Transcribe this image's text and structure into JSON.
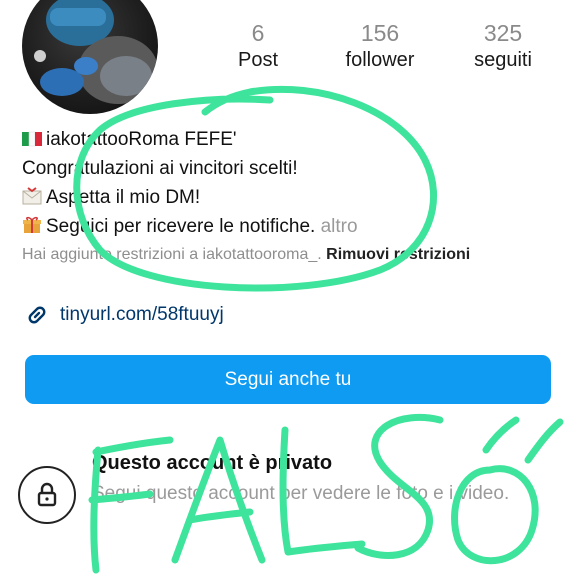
{
  "profile": {
    "stats": [
      {
        "count": "6",
        "label": "Post"
      },
      {
        "count": "156",
        "label": "follower"
      },
      {
        "count": "325",
        "label": "seguiti"
      }
    ],
    "bio": {
      "name": "iakotattooRoma FEFE'",
      "line1": "Congratulazioni ai vincitori scelti!",
      "line2": "Aspetta il mio DM!",
      "line3": "Seguici per ricevere le notifiche.",
      "more_label": "altro"
    },
    "restriction": {
      "text": "Hai aggiunto restrizioni a iakotattooroma_.",
      "action_label": "Rimuovi restrizioni"
    },
    "link": "tinyurl.com/58ftuuyj",
    "follow_button_label": "Segui anche tu",
    "private": {
      "title": "Questo account è privato",
      "subtitle": "Segui questo account per vedere le foto e i video."
    }
  },
  "icons": {
    "flag": "italy-flag-icon",
    "envelope": "envelope-icon",
    "gift": "gift-icon",
    "link": "link-icon",
    "lock": "lock-icon"
  },
  "overlay": {
    "scribble_text": "FALSO",
    "stroke_color": "#3ee39c"
  },
  "colors": {
    "follow_button": "#0f9bf2",
    "link": "#00376b",
    "muted_text": "#8e8e8e"
  }
}
